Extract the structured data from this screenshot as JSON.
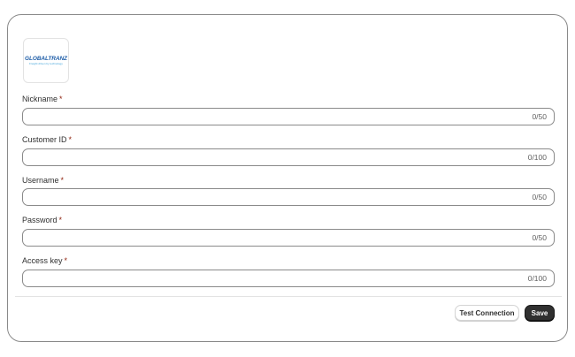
{
  "logo": {
    "name": "GLOBALTRANZ",
    "tagline": "Freight driven by technology"
  },
  "fields": [
    {
      "label": "Nickname",
      "required_mark": "*",
      "value": "",
      "counter": "0/50"
    },
    {
      "label": "Customer ID",
      "required_mark": "*",
      "value": "",
      "counter": "0/100"
    },
    {
      "label": "Username",
      "required_mark": "*",
      "value": "",
      "counter": "0/50"
    },
    {
      "label": "Password",
      "required_mark": "*",
      "value": "",
      "counter": "0/50"
    },
    {
      "label": "Access key",
      "required_mark": "*",
      "value": "",
      "counter": "0/100"
    }
  ],
  "actions": {
    "test_connection": "Test Connection",
    "save": "Save"
  },
  "colors": {
    "required": "#8e1f0b",
    "primary_button": "#303030",
    "brand_blue": "#1f5ea8"
  }
}
